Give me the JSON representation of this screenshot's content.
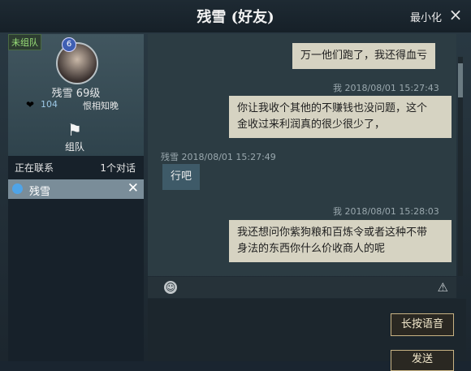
{
  "window": {
    "title": "残雪 (好友)",
    "minimize_label": "最小化",
    "close_icon": "×"
  },
  "profile": {
    "team_status": "未组队",
    "badge_icon": "6",
    "name": "残雪",
    "level": "69级",
    "likes": "104",
    "relation": "恨相知晚",
    "team_button_label": "组队"
  },
  "contacts": {
    "header_left": "正在联系",
    "header_right": "1个对话",
    "items": [
      {
        "name": "残雪"
      }
    ]
  },
  "messages": [
    {
      "sender": "me",
      "text": "万一他们跑了，我还得血亏"
    },
    {
      "sender": "me",
      "meta": "我   2018/08/01   15:27:43",
      "line1": "你让我收个其他的不赚钱也没问题，这个",
      "line2": "金收过来利润真的很少很少了，"
    },
    {
      "sender": "other",
      "meta": "残雪   2018/08/01   15:27:49",
      "text": "行吧"
    },
    {
      "sender": "me",
      "meta": "我   2018/08/01   15:28:03",
      "line1": "我还想问你紫狗粮和百炼令或者这种不带",
      "line2": "身法的东西你什么价收商人的呢"
    }
  ],
  "input": {
    "voice_label": "长按语音",
    "send_label": "发送"
  },
  "colors": {
    "my_bubble": "#d6d3c2",
    "other_bubble": "#3e5a68",
    "button_border": "#c8b384"
  }
}
